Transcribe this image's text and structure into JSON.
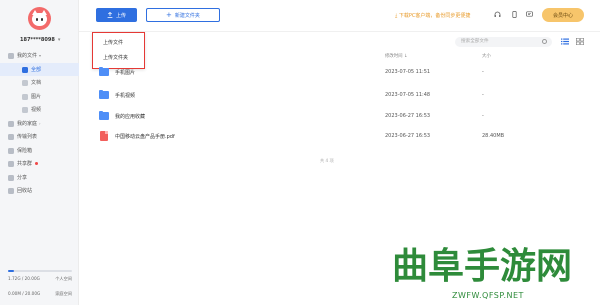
{
  "sidebar": {
    "username": "187****8098",
    "nav": [
      {
        "label": "我的文件",
        "level": 0,
        "caret": "▾",
        "icon": "cloud-icon",
        "dot": false,
        "active": false
      },
      {
        "label": "全部",
        "level": 1,
        "icon": "all-files-icon",
        "dot": false,
        "active": true
      },
      {
        "label": "文档",
        "level": 1,
        "icon": "document-icon",
        "dot": false,
        "active": false
      },
      {
        "label": "图片",
        "level": 1,
        "icon": "image-icon",
        "dot": false,
        "active": false
      },
      {
        "label": "视频",
        "level": 1,
        "icon": "video-icon",
        "dot": false,
        "active": false
      },
      {
        "label": "我的家庭",
        "level": 0,
        "caret": "›",
        "icon": "family-icon",
        "dot": false,
        "active": false
      },
      {
        "label": "传输列表",
        "level": 0,
        "icon": "transfer-icon",
        "dot": false,
        "active": false
      },
      {
        "label": "保险箱",
        "level": 0,
        "icon": "safe-icon",
        "dot": false,
        "active": false
      },
      {
        "label": "共享群",
        "level": 0,
        "icon": "share-group-icon",
        "dot": true,
        "active": false
      },
      {
        "label": "分享",
        "level": 0,
        "icon": "share-icon",
        "dot": false,
        "active": false
      },
      {
        "label": "回收站",
        "level": 0,
        "icon": "recycle-bin-icon",
        "dot": false,
        "active": false
      }
    ],
    "storage": {
      "used": "1.72G / 20.00G",
      "personal_label": "个人空间",
      "family_used": "0.00M / 20.00G",
      "family_label": "家庭空间",
      "used_fraction": 0.086
    }
  },
  "header": {
    "upload_label": "上传",
    "new_folder_label": "新建文件夹",
    "download_pc": "下载PC客户端，备份同步更便捷",
    "vip_label": "会员中心"
  },
  "upload_menu": {
    "items": [
      "上传文件",
      "上传文件夹"
    ]
  },
  "toolbar": {
    "search_placeholder": "搜索全部文件"
  },
  "table": {
    "columns": {
      "modified": "修改时间 ↓",
      "size": "大小"
    },
    "rows": [
      {
        "type": "folder",
        "name": "手机图片",
        "date": "2023-07-05  11:51",
        "size": "-"
      },
      {
        "type": "folder",
        "name": "手机视频",
        "date": "2023-07-05  11:48",
        "size": "-"
      },
      {
        "type": "folder",
        "name": "我的应用收藏",
        "date": "2023-06-27  16:53",
        "size": "-"
      },
      {
        "type": "pdf",
        "name": "中国移动云盘产品手册.pdf",
        "date": "2023-06-27  16:53",
        "size": "28.40MB"
      }
    ],
    "total": "共 4 项"
  },
  "watermark": {
    "title": "曲阜手游网",
    "url": "ZWFW.QFSP.NET"
  },
  "colors": {
    "accent": "#2f6fe0",
    "vip": "#f7c56b",
    "watermark": "#2e8b3a",
    "highlight_box": "#e53935"
  }
}
